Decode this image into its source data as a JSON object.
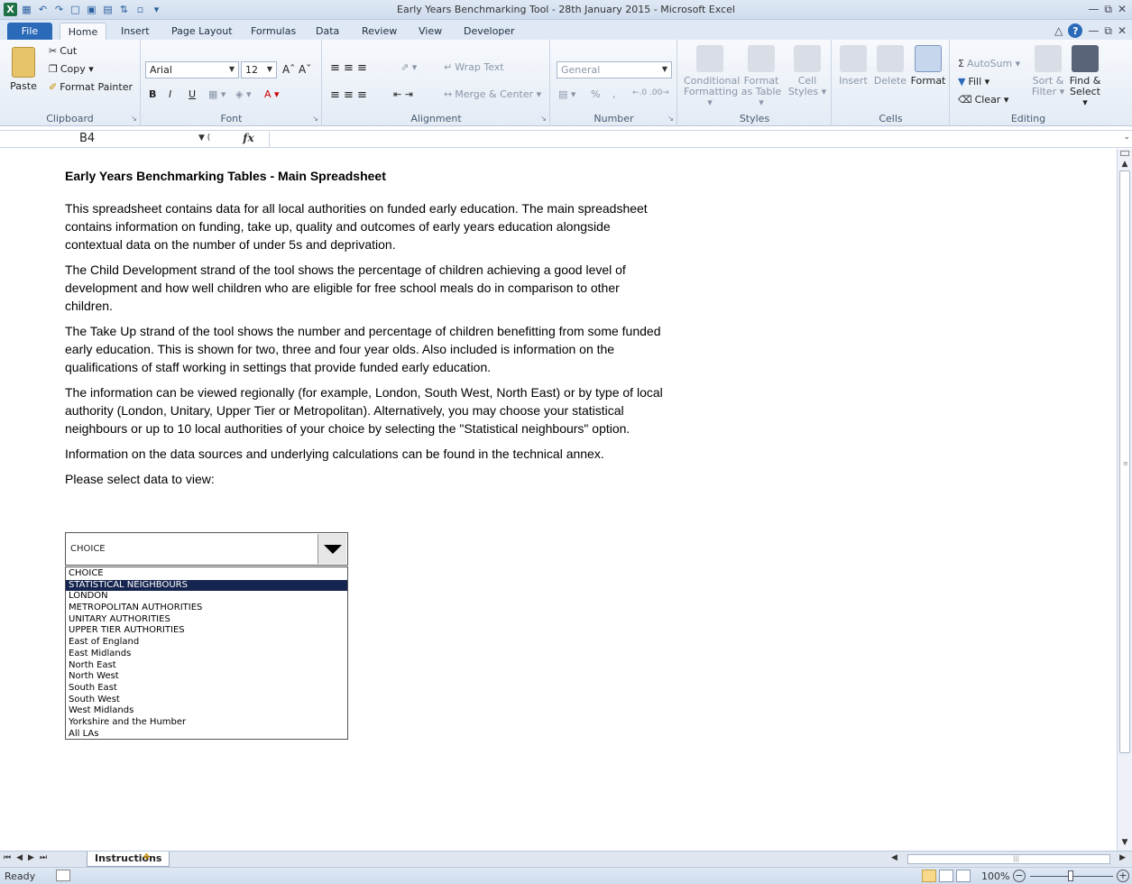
{
  "window": {
    "title": "Early Years Benchmarking Tool - 28th January 2015  -  Microsoft Excel"
  },
  "ribbon_tabs": [
    "File",
    "Home",
    "Insert",
    "Page Layout",
    "Formulas",
    "Data",
    "Review",
    "View",
    "Developer"
  ],
  "active_tab": "Home",
  "ribbon": {
    "clipboard": {
      "label": "Clipboard",
      "paste": "Paste",
      "cut": "Cut",
      "copy": "Copy ▾",
      "format_painter": "Format Painter"
    },
    "font": {
      "label": "Font",
      "font_name": "Arial",
      "font_size": "12",
      "bold": "B",
      "italic": "I",
      "underline": "U"
    },
    "alignment": {
      "label": "Alignment",
      "wrap_text": "Wrap Text",
      "merge_center": "Merge & Center ▾"
    },
    "number": {
      "label": "Number",
      "format": "General",
      "percent": "%",
      "comma": ","
    },
    "styles": {
      "label": "Styles",
      "conditional": "Conditional Formatting ▾",
      "format_table": "Format as Table ▾",
      "cell_styles": "Cell Styles ▾"
    },
    "cells": {
      "label": "Cells",
      "insert": "Insert",
      "delete": "Delete",
      "format": "Format"
    },
    "editing": {
      "label": "Editing",
      "autosum": "AutoSum ▾",
      "fill": "Fill ▾",
      "clear": "Clear ▾",
      "sort_filter": "Sort & Filter ▾",
      "find_select": "Find & Select ▾"
    }
  },
  "formula_bar": {
    "name_box": "B4",
    "fx": "fx",
    "formula": ""
  },
  "sheet": {
    "heading": "Early Years Benchmarking Tables - Main Spreadsheet",
    "paragraphs": [
      "This spreadsheet contains data for all local authorities on funded early education. The main spreadsheet contains information on funding, take up, quality and outcomes of early years education alongside contextual data on the number of under 5s and deprivation.",
      "The Child Development strand of the tool shows the percentage of children achieving a good level of development and how well children who are eligible for free school meals do in comparison to other children.",
      "The Take Up strand of the tool shows the number and percentage of children benefitting from some funded early education. This is shown for two, three and four year olds. Also included is information on the qualifications of staff working in settings that provide funded early education.",
      "The information can be viewed regionally (for example, London, South West, North East) or by type of local authority (London, Unitary, Upper Tier or Metropolitan). Alternatively, you may choose your statistical neighbours or up to 10 local authorities of your choice by selecting the \"Statistical neighbours\" option.",
      "Information on the data sources and underlying calculations can be found in the technical annex."
    ],
    "select_prompt": "Please select data to view:"
  },
  "dropdown": {
    "value": "CHOICE",
    "highlighted_index": 1,
    "options": [
      "CHOICE",
      "STATISTICAL NEIGHBOURS",
      "LONDON",
      "METROPOLITAN AUTHORITIES",
      "UNITARY AUTHORITIES",
      "UPPER TIER AUTHORITIES",
      "East of England",
      "East Midlands",
      "North East",
      "North West",
      "South East",
      "South West",
      "West Midlands",
      "Yorkshire and the Humber",
      "All LAs"
    ]
  },
  "sheet_tabs": {
    "active": "Instructions"
  },
  "status": {
    "text": "Ready",
    "zoom": "100%"
  },
  "colors": {
    "accent": "#2a6ab8",
    "selection": "#16254f"
  }
}
